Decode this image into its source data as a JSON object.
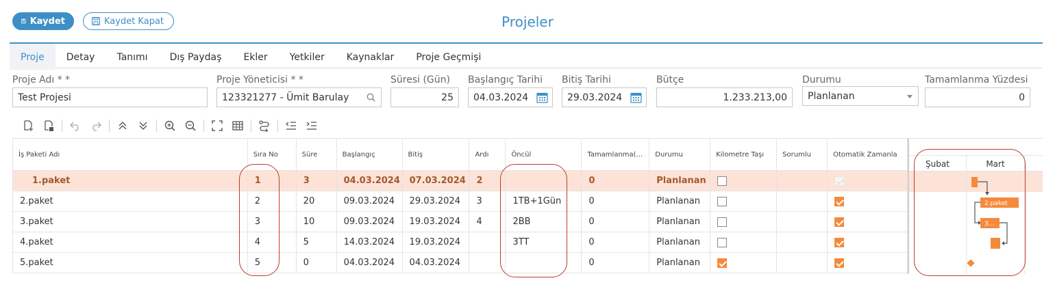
{
  "header": {
    "save_label": "Kaydet",
    "save_close_label": "Kaydet Kapat",
    "title": "Projeler"
  },
  "tabs": [
    "Proje",
    "Detay",
    "Tanımı",
    "Dış Paydaş",
    "Ekler",
    "Yetkiler",
    "Kaynaklar",
    "Proje Geçmişi"
  ],
  "form": {
    "project_name": {
      "label": "Proje Adı * *",
      "value": "Test Projesi"
    },
    "manager": {
      "label": "Proje Yöneticisi * *",
      "value": "123321277 - Ümit Barulay"
    },
    "duration": {
      "label": "Süresi (Gün)",
      "value": "25"
    },
    "start": {
      "label": "Başlangıç Tarihi",
      "value": "04.03.2024"
    },
    "end": {
      "label": "Bitiş Tarihi",
      "value": "29.03.2024"
    },
    "budget": {
      "label": "Bütçe",
      "value": "1.233.213,00"
    },
    "status": {
      "label": "Durumu",
      "value": "Planlanan"
    },
    "completion": {
      "label": "Tamamlanma Yüzdesi",
      "value": "0"
    }
  },
  "grid": {
    "columns": [
      "İş Paketi Adı",
      "Sıra No",
      "Süre",
      "Başlangıç",
      "Bitiş",
      "Ardı",
      "Öncül",
      "Tamamlanma(...",
      "Durumu",
      "Kilometre Taşı",
      "Sorumlu",
      "Otomatik Zamanla"
    ],
    "rows": [
      {
        "name": "1.paket",
        "sira": "1",
        "sure": "3",
        "baslangic": "04.03.2024",
        "bitis": "07.03.2024",
        "ardi": "2",
        "oncul": "",
        "tamamlanma": "0",
        "durum": "Planlanan",
        "milestone": false,
        "sorumlu": "",
        "auto": true
      },
      {
        "name": "2.paket",
        "sira": "2",
        "sure": "20",
        "baslangic": "09.03.2024",
        "bitis": "29.03.2024",
        "ardi": "3",
        "oncul": "1TB+1Gün",
        "tamamlanma": "0",
        "durum": "Planlanan",
        "milestone": false,
        "sorumlu": "",
        "auto": true
      },
      {
        "name": "3.paket",
        "sira": "3",
        "sure": "10",
        "baslangic": "09.03.2024",
        "bitis": "19.03.2024",
        "ardi": "4",
        "oncul": "2BB",
        "tamamlanma": "0",
        "durum": "Planlanan",
        "milestone": false,
        "sorumlu": "",
        "auto": true
      },
      {
        "name": "4.paket",
        "sira": "4",
        "sure": "5",
        "baslangic": "14.03.2024",
        "bitis": "19.03.2024",
        "ardi": "",
        "oncul": "3TT",
        "tamamlanma": "0",
        "durum": "Planlanan",
        "milestone": false,
        "sorumlu": "",
        "auto": true
      },
      {
        "name": "5.paket",
        "sira": "5",
        "sure": "0",
        "baslangic": "04.03.2024",
        "bitis": "04.03.2024",
        "ardi": "",
        "oncul": "",
        "tamamlanma": "0",
        "durum": "Planlanan",
        "milestone": true,
        "sorumlu": "",
        "auto": true
      }
    ]
  },
  "gantt": {
    "months": [
      "Şubat",
      "Mart"
    ],
    "bar_labels": [
      "2.paket",
      "3..."
    ],
    "bar_color": "#f58a3c"
  },
  "colors": {
    "accent": "#3d8fc6",
    "selected_row": "#fde3d7",
    "annotation": "#c0392b"
  }
}
